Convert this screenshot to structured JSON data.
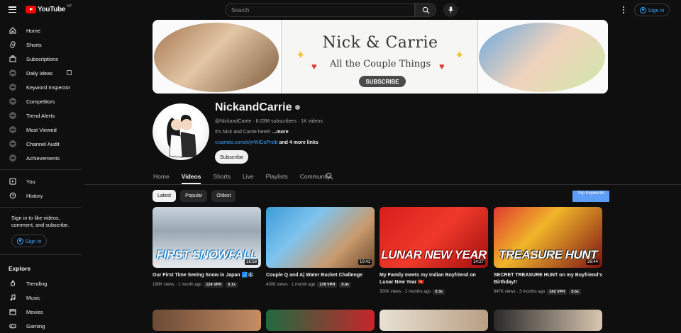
{
  "header": {
    "logo_text": "YouTube",
    "country_code": "MT",
    "search_placeholder": "Search",
    "signin_label": "Sign in"
  },
  "sidebar": {
    "main": [
      {
        "label": "Home",
        "icon": "home-icon"
      },
      {
        "label": "Shorts",
        "icon": "shorts-icon"
      },
      {
        "label": "Subscriptions",
        "icon": "subscriptions-icon"
      },
      {
        "label": "Daily Ideas",
        "icon": "extension-icon"
      },
      {
        "label": "Keyword Inspector",
        "icon": "extension-icon"
      },
      {
        "label": "Competitors",
        "icon": "extension-icon"
      },
      {
        "label": "Trend Alerts",
        "icon": "extension-icon"
      },
      {
        "label": "Most Viewed",
        "icon": "extension-icon"
      },
      {
        "label": "Channel Audit",
        "icon": "extension-icon"
      },
      {
        "label": "Achievements",
        "icon": "extension-icon"
      }
    ],
    "you": [
      {
        "label": "You",
        "icon": "you-icon"
      },
      {
        "label": "History",
        "icon": "history-icon"
      }
    ],
    "signin_prompt": "Sign in to like videos, comment, and subscribe.",
    "signin_label": "Sign in",
    "explore_title": "Explore",
    "explore": [
      {
        "label": "Trending",
        "icon": "trending-icon"
      },
      {
        "label": "Music",
        "icon": "music-icon"
      },
      {
        "label": "Movies",
        "icon": "movies-icon"
      },
      {
        "label": "Gaming",
        "icon": "gaming-icon"
      }
    ]
  },
  "banner": {
    "title": "Nick & Carrie",
    "subtitle": "All the Couple Things",
    "button": "SUBSCRIBE"
  },
  "channel": {
    "name": "NickandCarrie",
    "meta": "@NickandCarrie · 8.03M subscribers · 1K videos",
    "description": "It's Nick and Carrie here!!",
    "more": "...more",
    "link": "v.cameo.com/e/yrWICoPrsIb",
    "more_links": " and 4 more links",
    "subscribe": "Subscribe"
  },
  "tabs": [
    "Home",
    "Videos",
    "Shorts",
    "Live",
    "Playlists",
    "Community"
  ],
  "active_tab": "Videos",
  "chips": [
    "Latest",
    "Popular",
    "Oldest"
  ],
  "top_keywords": "Top Keywords",
  "videos": [
    {
      "title": "Our First Time Seeing Snow in Japan 🗾❄️",
      "caption": "FIRST SNOWFALL",
      "duration": "16:58",
      "views": "168K views · 1 month ago",
      "vph": "124 VPH",
      "mult": "0.1x"
    },
    {
      "title": "Couple Q and A| Water Bucket Challenge",
      "caption": "",
      "duration": "10:41",
      "views": "430K views · 1 month ago",
      "vph": "178 VPH",
      "mult": "0.4x"
    },
    {
      "title": "My Family meets my Indian Boyfriend on Lunar New Year 🇭🇰",
      "caption": "LUNAR NEW YEAR",
      "duration": "14:27",
      "views": "300K views · 2 months ago",
      "vph": "",
      "mult": "0.3x"
    },
    {
      "title": "SECRET TREASURE HUNT on my Boyfriend's Birthday!!",
      "caption": "TREASURE HUNT",
      "duration": "26:44",
      "views": "647K views · 3 months ago",
      "vph": "142 VPH",
      "mult": "0.6x"
    }
  ]
}
